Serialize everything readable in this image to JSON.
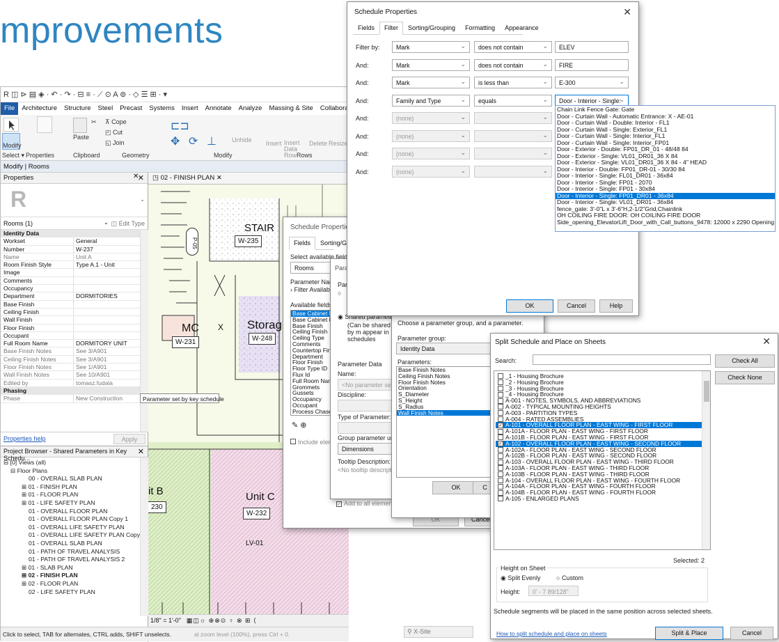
{
  "slide": {
    "title": "mprovements"
  },
  "revit": {
    "qat": "R ◫ ⊳ ▤ ◈ · ↶ · ↷ · ⊟ ≡ · ⟋ ⊙ A ⊚ · ◇ ☰ ⊞ · ▾",
    "tabs": [
      "File",
      "Architecture",
      "Structure",
      "Steel",
      "Precast",
      "Systems",
      "Insert",
      "Annotate",
      "Analyze",
      "Massing & Site",
      "Collaborate"
    ],
    "ribbon": {
      "modify": "Modify",
      "paste": "Paste",
      "cope": "Cope",
      "cut": "Cut",
      "join": "Join",
      "unhide": "Unhide",
      "insert": "Insert",
      "insert_data_row": "Insert Data Row",
      "delete": "Delete",
      "resize": "Resize",
      "groups": [
        "Select ▾",
        "Properties",
        "Clipboard",
        "Geometry",
        "Modify",
        "Rows"
      ]
    },
    "modify_bar": "Modify | Rooms",
    "properties": {
      "header": "Properties",
      "type_selector": "Rooms (1)",
      "edit_type": "Edit Type",
      "rows": [
        {
          "k": "Identity Data",
          "v": "",
          "kind": "sec"
        },
        {
          "k": "Workset",
          "v": "General",
          "kind": ""
        },
        {
          "k": "Number",
          "v": "W-237",
          "kind": ""
        },
        {
          "k": "Name",
          "v": "Unit A",
          "kind": "dim"
        },
        {
          "k": "Room Finish Style",
          "v": "Type A.1 - Unit",
          "kind": ""
        },
        {
          "k": "Image",
          "v": "",
          "kind": ""
        },
        {
          "k": "Comments",
          "v": "",
          "kind": ""
        },
        {
          "k": "Occupancy",
          "v": "",
          "kind": ""
        },
        {
          "k": "Department",
          "v": "DORMITORIES",
          "kind": ""
        },
        {
          "k": "Base Finish",
          "v": "",
          "kind": ""
        },
        {
          "k": "Ceiling Finish",
          "v": "",
          "kind": ""
        },
        {
          "k": "Wall Finish",
          "v": "",
          "kind": ""
        },
        {
          "k": "Floor Finish",
          "v": "",
          "kind": ""
        },
        {
          "k": "Occupant",
          "v": "",
          "kind": ""
        },
        {
          "k": "Full Room Name",
          "v": "DORMITORY UNIT",
          "kind": ""
        },
        {
          "k": "Base Finish Notes",
          "v": "See 3/A901",
          "kind": "dim"
        },
        {
          "k": "Ceiling Finish Notes",
          "v": "See 3/A901",
          "kind": "dim"
        },
        {
          "k": "Floor Finish Notes",
          "v": "See 1/A901",
          "kind": "dim"
        },
        {
          "k": "Wall Finish Notes",
          "v": "See 10/A901",
          "kind": "dim"
        },
        {
          "k": "Edited by",
          "v": "tomasz.fudala",
          "kind": "dim"
        },
        {
          "k": "Phasing",
          "v": "",
          "kind": "sec"
        },
        {
          "k": "Phase",
          "v": "New Construction",
          "kind": "dim"
        }
      ],
      "help": "Properties help",
      "apply": "Apply",
      "tooltip": "Parameter set by key schedule"
    },
    "browser": {
      "header": "Project Browser - Shared Parameters in Key Schedu...",
      "items": [
        {
          "t": "⊟ [0] Views (all)",
          "ind": 4,
          "b": false
        },
        {
          "t": "⊟ Floor Plans",
          "ind": 14,
          "b": false
        },
        {
          "t": "00 - OVERALL SLAB PLAN",
          "ind": 40,
          "b": false
        },
        {
          "t": "⊞ 01 - FINISH PLAN",
          "ind": 30,
          "b": false
        },
        {
          "t": "⊞ 01 - FLOOR PLAN",
          "ind": 30,
          "b": false
        },
        {
          "t": "⊞ 01 - LIFE SAFETY PLAN",
          "ind": 30,
          "b": false
        },
        {
          "t": "01 - OVERALL FLOOR PLAN",
          "ind": 40,
          "b": false
        },
        {
          "t": "01 - OVERALL FLOOR PLAN Copy 1",
          "ind": 40,
          "b": false
        },
        {
          "t": "01 - OVERALL LIFE SAFETY PLAN",
          "ind": 40,
          "b": false
        },
        {
          "t": "01 - OVERALL LIFE SAFETY PLAN Copy",
          "ind": 40,
          "b": false
        },
        {
          "t": "01 - OVERALL SLAB PLAN",
          "ind": 40,
          "b": false
        },
        {
          "t": "01 - PATH OF TRAVEL ANALYSIS",
          "ind": 40,
          "b": false
        },
        {
          "t": "01 - PATH OF TRAVEL ANALYSIS 2",
          "ind": 40,
          "b": false
        },
        {
          "t": "⊞ 01 - SLAB PLAN",
          "ind": 30,
          "b": false
        },
        {
          "t": "⊞ 02 - FINISH PLAN",
          "ind": 30,
          "b": true
        },
        {
          "t": "⊞ 02 - FLOOR PLAN",
          "ind": 30,
          "b": false
        },
        {
          "t": "02 - LIFE SAFETY PLAN",
          "ind": 40,
          "b": false
        }
      ]
    },
    "status": "Click to select, TAB for alternates, CTRL adds, SHIFT unselects.",
    "status_tail": "al zoom level (100%), press Ctrl + 0.",
    "view_tab": "02 - FINISH PLAN",
    "view_scale": "1/8\" = 1'-0\"",
    "workset": "X-Site",
    "plan": {
      "stair": "STAIR",
      "stair_tag": "W-235",
      "p05": "P-05",
      "mc": "MC",
      "mc_tag": "W-231",
      "storage": "Storage",
      "storage_tag": "W-248",
      "unit_b": "it B",
      "unit_b_tag": "230",
      "unit_c": "Unit C",
      "unit_c_tag": "W-232",
      "lv": "LV-01",
      "x": "X"
    }
  },
  "filter_dialog": {
    "title": "Schedule Properties",
    "tabs": [
      "Fields",
      "Filter",
      "Sorting/Grouping",
      "Formatting",
      "Appearance"
    ],
    "rows": [
      {
        "label": "Filter by:",
        "field": "Mark",
        "op": "does not contain",
        "value": "ELEV",
        "dis": false
      },
      {
        "label": "And:",
        "field": "Mark",
        "op": "does not contain",
        "value": "FIRE",
        "dis": false
      },
      {
        "label": "And:",
        "field": "Mark",
        "op": "is less than",
        "value": "E-300",
        "dis": false
      },
      {
        "label": "And:",
        "field": "Family and Type",
        "op": "equals",
        "value": "Door - Interior - Single:",
        "dis": false
      },
      {
        "label": "And:",
        "field": "(none)",
        "op": "",
        "value": "",
        "dis": false
      },
      {
        "label": "And:",
        "field": "(none)",
        "op": "",
        "value": "",
        "dis": true
      },
      {
        "label": "And:",
        "field": "(none)",
        "op": "",
        "value": "",
        "dis": true
      },
      {
        "label": "And:",
        "field": "(none)",
        "op": "",
        "value": "",
        "dis": true
      }
    ],
    "ok": "OK",
    "cancel": "Cancel",
    "help": "Help",
    "options": [
      "Chain Link Fence Gate: Gate",
      "Door - Curtain Wall - Automatic Entrance: X - AE-01",
      "Door - Curtain Wall - Double: Interior - FL1",
      "Door - Curtain Wall - Single: Exterior_FL1",
      "Door - Curtain Wall - Single: Interior_FL1",
      "Door - Curtain Wall - Single: Interior_FP01",
      "Door - Exterior - Double: FP01_DR_01 - 48/48 84",
      "Door - Exterior - Single: VL01_DR01_36 X 84",
      "Door - Exterior - Single: VL01_DR01_36 X 84 - 4\" HEAD",
      "Door - Interior - Double: FP01_DR-01 - 30/30 84",
      "Door - Interior - Single: FL01_DR01 - 36x84",
      "Door - Interior - Single: FP01 - 2070",
      "Door - Interior - Single: FP01 - 30x84",
      "Door - Interior - Single: FP01_DR01 - 36x84",
      "Door - Interior - Single: VL01_DR01 - 36x84",
      "fence_gate: 3'-0\"L x 3'-6\"H,2-1/2\"Grid,Chainlink",
      "OH COILING FIRE DOOR: OH COILING FIRE DOOR",
      "Side_opening_ElevatorLift_Door_with_Call_buttons_9478: 12000 x 2290 Opening"
    ],
    "selected_index": 13
  },
  "fields_dialog": {
    "title": "Schedule Properties",
    "tabs": [
      "Fields",
      "Sorting/Grouping"
    ],
    "select_label": "Select available fields fro",
    "category": "Rooms",
    "param_name": "Parameter Name :",
    "filter_avail": "Filter Available",
    "avail_label": "Available fields:",
    "fields": [
      "Base Cabinet Fin",
      "Base Cabinet Loc",
      "Base Finish",
      "Ceiling Finish",
      "Ceiling Type",
      "Comments",
      "Countertop Finis",
      "Department",
      "Floor Finish",
      "Floor Type ID",
      "Flux Id",
      "Full Room Name",
      "Grommets",
      "Gussets",
      "Occupancy",
      "Occupant",
      "Process Chase Fi"
    ],
    "include": "Include eleme",
    "add_all": "Add to all elements in the category",
    "ok": "OK",
    "cancel": "Cancel"
  },
  "param_dialog": {
    "title": "Para",
    "type_label": "Par",
    "shared": "Shared parameter",
    "shared_desc": "(Can be shared by m appear in schedules",
    "data_header": "Parameter Data",
    "name_label": "Name:",
    "name_placeholder": "<No parameter selecte",
    "discipline": "Discipline:",
    "type_of_param": "Type of Parameter:",
    "group_under": "Group parameter under:",
    "group_value": "Dimensions",
    "tooltip_label": "Tooltip Description:",
    "tooltip_value": "<No tooltip description.",
    "ok": "OK"
  },
  "shared_dialog": {
    "instruction": "Choose a parameter group, and a parameter.",
    "group_label": "Parameter group:",
    "group_value": "Identity Data",
    "params_label": "Parameters:",
    "params": [
      "Base Finish Notes",
      "Ceiling Finish Notes",
      "Floor Finish Notes",
      "Orientation",
      "S_Diameter",
      "S_Height",
      "S_Radius",
      "Wall Finish Notes"
    ],
    "selected_index": 7,
    "ok": "OK",
    "c": "C"
  },
  "split_dialog": {
    "title": "Split Schedule and Place on Sheets",
    "search_label": "Search:",
    "check_all": "Check All",
    "check_none": "Check None",
    "sheets": [
      {
        "t": "_1 - Housing Brochure",
        "c": false
      },
      {
        "t": "_2 - Housing Brochure",
        "c": false
      },
      {
        "t": "_3 - Housing Brochure",
        "c": false
      },
      {
        "t": "_4 - Housing Brochure",
        "c": false
      },
      {
        "t": "A-001 - NOTES, SYMBOLS, AND ABBREVIATIONS",
        "c": false
      },
      {
        "t": "A-002 - TYPICAL MOUNTING HEIGHTS",
        "c": false
      },
      {
        "t": "A-003 - PARTITION TYPES",
        "c": false
      },
      {
        "t": "A-004 - RATED ASSEMBLIES",
        "c": false
      },
      {
        "t": "A-101 - OVERALL FLOOR PLAN - EAST WING - FIRST FLOOR",
        "c": true
      },
      {
        "t": "A-101A - FLOOR PLAN - EAST WING - FIRST FLOOR",
        "c": false
      },
      {
        "t": "A-101B - FLOOR PLAN - EAST WING - FIRST FLOOR",
        "c": false
      },
      {
        "t": "A-102 - OVERALL FLOOR PLAN - EAST WING - SECOND FLOOR",
        "c": true
      },
      {
        "t": "A-102A - FLOOR PLAN - EAST WING - SECOND FLOOR",
        "c": false
      },
      {
        "t": "A-102B - FLOOR PLAN - EAST WING - SECOND FLOOR",
        "c": false
      },
      {
        "t": "A-103 - OVERALL FLOOR PLAN - EAST WING - THIRD FLOOR",
        "c": false
      },
      {
        "t": "A-103A - FLOOR PLAN - EAST WING - THIRD FLOOR",
        "c": false
      },
      {
        "t": "A-103B - FLOOR PLAN - EAST WING - THIRD FLOOR",
        "c": false
      },
      {
        "t": "A-104 - OVERALL FLOOR PLAN - EAST WING - FOURTH FLOOR",
        "c": false
      },
      {
        "t": "A-104A - FLOOR PLAN - EAST WING - FOURTH FLOOR",
        "c": false
      },
      {
        "t": "A-104B - FLOOR PLAN - EAST WING - FOURTH FLOOR",
        "c": false
      },
      {
        "t": "A-105 - ENLARGED PLANS",
        "c": false
      }
    ],
    "selected": "Selected: 2",
    "height_group": "Height on Sheet",
    "split_evenly": "Split Evenly",
    "custom": "Custom",
    "height_label": "Height:",
    "height_value": "0' - 7 89/128\"",
    "note": "Schedule segments will be placed in the same position across selected sheets.",
    "howto": "How to split schedule and place on sheets",
    "split_place": "Split & Place",
    "cancel": "Cancel"
  },
  "colors": {
    "accent": "#2e86c1",
    "selection": "#0078d7",
    "file_tab": "#1e5ca8"
  }
}
